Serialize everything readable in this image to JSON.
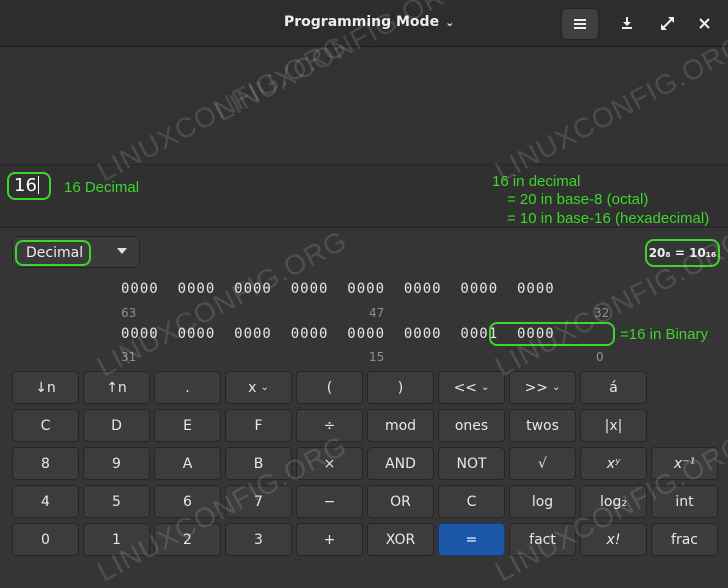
{
  "header": {
    "title": "Programming Mode",
    "menu_icon": "hamburger-menu-icon",
    "download_icon": "download-icon",
    "fullscreen_icon": "fullscreen-icon",
    "close_icon": "close-icon"
  },
  "display": {
    "entry_value": "16",
    "entry_note": "16 Decimal",
    "annotation_line1": "16 in decimal",
    "annotation_line2": "= 20 in base-8 (octal)",
    "annotation_line3": "= 10 in base-16 (hexadecimal)"
  },
  "base_select": {
    "value": "Decimal"
  },
  "conversion": "20₈ = 10₁₆",
  "bits": {
    "row1": "0000  0000  0000  0000  0000  0000  0000  0000",
    "row1_labels": [
      "63",
      "47",
      "32"
    ],
    "row2": "0000  0000  0000  0000  0000  0000  0001  0000",
    "row2_labels": [
      "31",
      "15",
      "0"
    ],
    "binary_note": "=16 in Binary"
  },
  "keys": [
    [
      "↓n",
      "↑n",
      ".",
      "x",
      "(",
      ")",
      "<<",
      ">>",
      "á"
    ],
    [
      "C",
      "D",
      "E",
      "F",
      "÷",
      "mod",
      "ones",
      "twos",
      "|x|"
    ],
    [
      "8",
      "9",
      "A",
      "B",
      "×",
      "AND",
      "NOT",
      "√",
      "xʸ",
      "x⁻¹"
    ],
    [
      "4",
      "5",
      "6",
      "7",
      "−",
      "OR",
      "C",
      "log",
      "log₂",
      "int"
    ],
    [
      "0",
      "1",
      "2",
      "3",
      "+",
      "XOR",
      "=",
      "fact",
      "x!",
      "frac"
    ]
  ],
  "watermark": "LINUXCONFIG.ORG",
  "colors": {
    "annotation": "#3dd62b",
    "equals_button": "#1c58a7"
  }
}
